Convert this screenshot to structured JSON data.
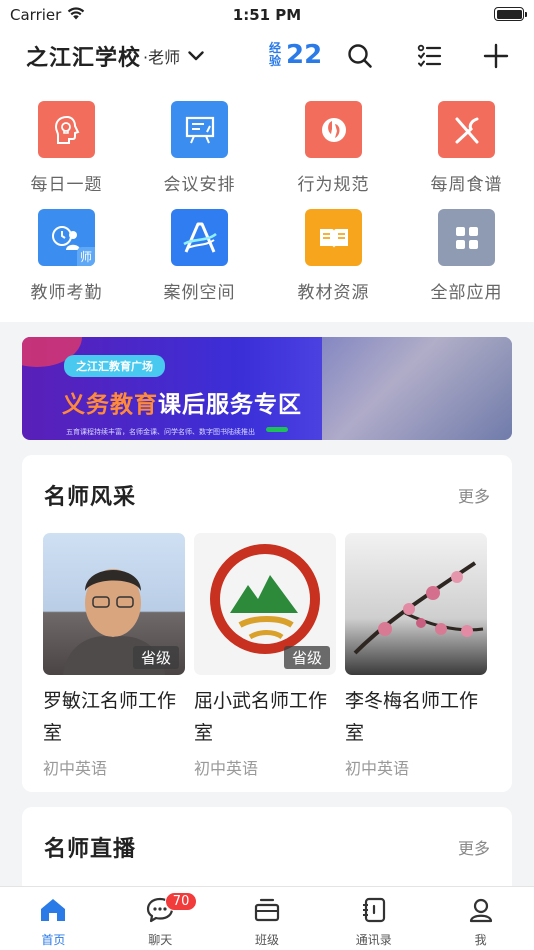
{
  "status": {
    "carrier": "Carrier",
    "time": "1:51 PM"
  },
  "header": {
    "school": "之江汇学校",
    "role": "·老师",
    "exp_label": "经验",
    "exp_value": "22"
  },
  "apps": [
    {
      "label": "每日一题",
      "icon": "lightbulb-head-icon",
      "color": "#f26d5b"
    },
    {
      "label": "会议安排",
      "icon": "presentation-icon",
      "color": "#3b8ef0"
    },
    {
      "label": "行为规范",
      "icon": "rules-icon",
      "color": "#f26d5b"
    },
    {
      "label": "每周食谱",
      "icon": "cutlery-icon",
      "color": "#f26d5b"
    },
    {
      "label": "教师考勤",
      "icon": "teacher-attendance-icon",
      "color": "#3b8ef0",
      "tag": "师"
    },
    {
      "label": "案例空间",
      "icon": "case-space-icon",
      "color": "#2f7df0"
    },
    {
      "label": "教材资源",
      "icon": "book-icon",
      "color": "#f7a51c"
    },
    {
      "label": "全部应用",
      "icon": "grid-apps-icon",
      "color": "#8e9bb3"
    }
  ],
  "banner": {
    "pill": "之江汇教育广场",
    "title_highlight": "义务教育",
    "title_rest": "课后服务专区",
    "subtitle": "五育课程持续丰富，名师金课、问学名师、数字图书陆续推出"
  },
  "famous_teachers": {
    "title": "名师风采",
    "more": "更多",
    "items": [
      {
        "name": "罗敏江名师工作室",
        "level": "省级",
        "subject": "初中英语"
      },
      {
        "name": "屈小武名师工作室",
        "level": "省级",
        "subject": "初中英语"
      },
      {
        "name": "李冬梅名师工作室",
        "level": "",
        "subject": "初中英语"
      }
    ]
  },
  "live": {
    "title": "名师直播",
    "more": "更多"
  },
  "tabbar": {
    "items": [
      {
        "label": "首页",
        "active": true
      },
      {
        "label": "聊天",
        "badge": "70"
      },
      {
        "label": "班级"
      },
      {
        "label": "通讯录"
      },
      {
        "label": "我"
      }
    ]
  },
  "colors": {
    "accent": "#2a7ae8",
    "badge": "#f23b3b"
  }
}
